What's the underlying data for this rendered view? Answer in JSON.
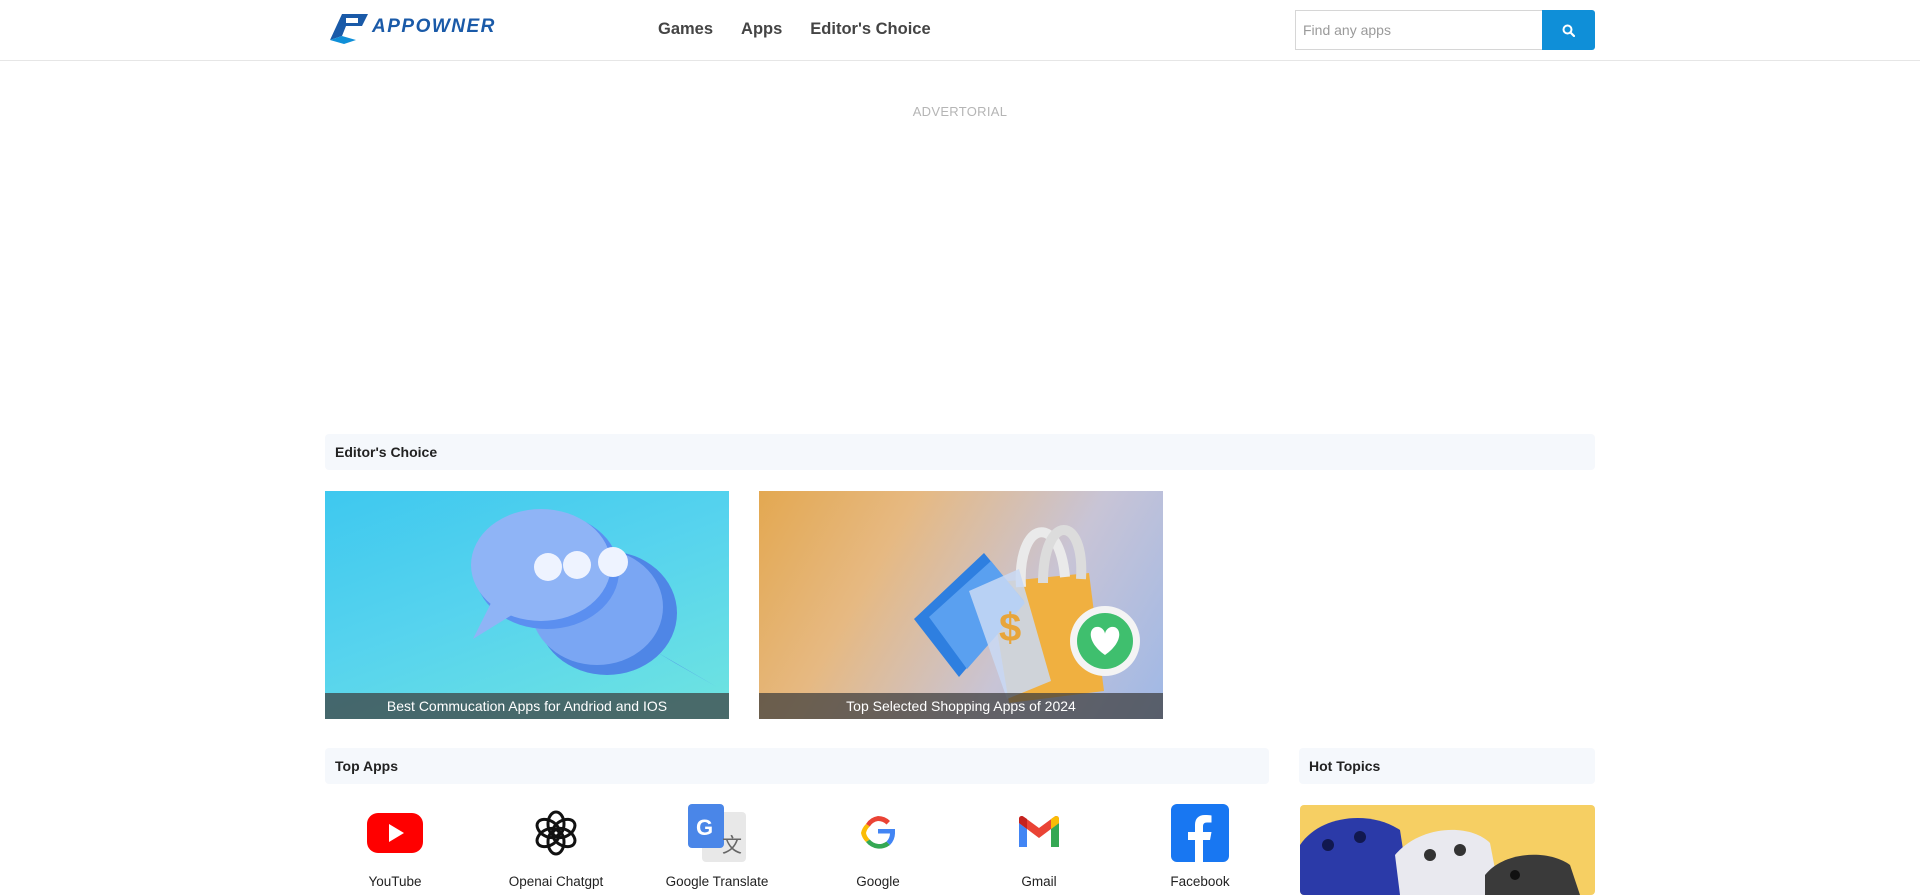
{
  "header": {
    "logo_text": "APPOWNER",
    "nav": [
      "Games",
      "Apps",
      "Editor's Choice"
    ],
    "search_placeholder": "Find any apps"
  },
  "ad": {
    "label": "ADVERTORIAL"
  },
  "editors_choice": {
    "title": "Editor's Choice",
    "cards": [
      {
        "caption": "Best Commucation Apps for Andriod and IOS"
      },
      {
        "caption": "Top Selected Shopping Apps of 2024"
      }
    ]
  },
  "top_apps": {
    "title": "Top Apps",
    "items": [
      {
        "name": "YouTube",
        "icon": "youtube-icon"
      },
      {
        "name": "Openai Chatgpt",
        "icon": "openai-icon"
      },
      {
        "name": "Google Translate",
        "icon": "google-translate-icon"
      },
      {
        "name": "Google",
        "icon": "google-icon"
      },
      {
        "name": "Gmail",
        "icon": "gmail-icon"
      },
      {
        "name": "Facebook",
        "icon": "facebook-icon"
      }
    ]
  },
  "hot_topics": {
    "title": "Hot Topics"
  },
  "colors": {
    "accent": "#0f8fd8",
    "section_bg": "#f5f8fc"
  }
}
